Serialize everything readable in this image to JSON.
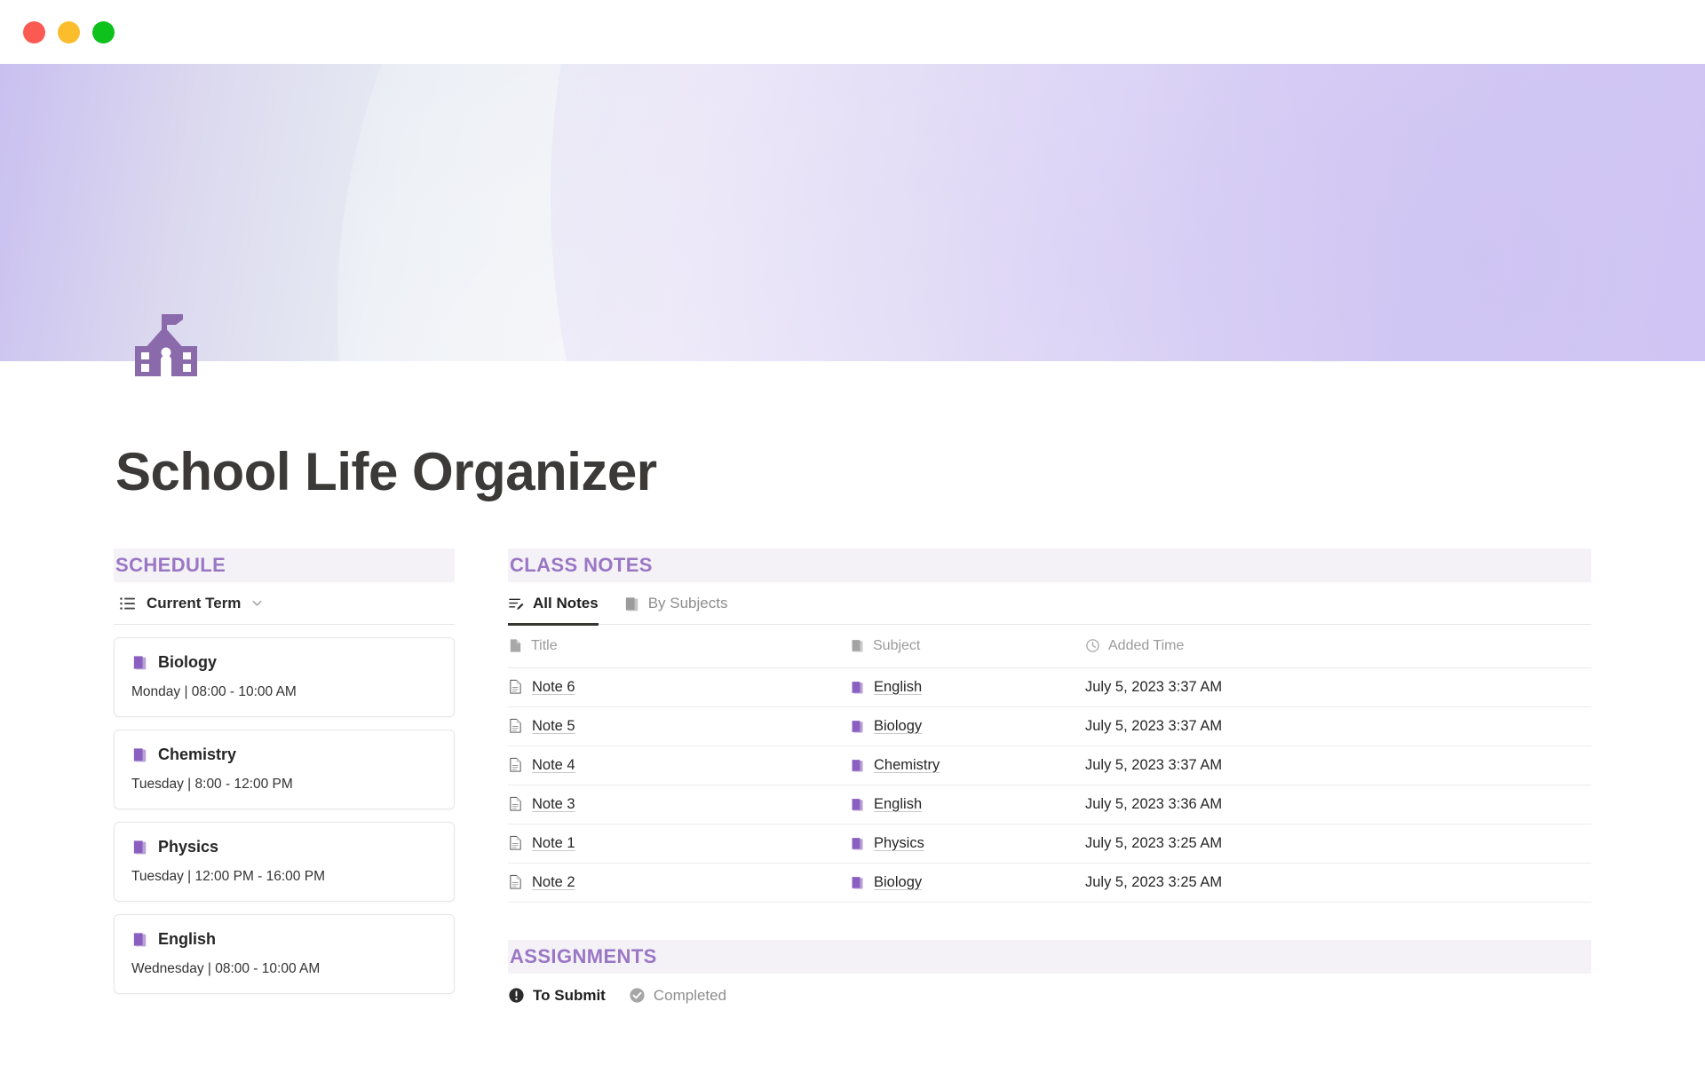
{
  "window": {
    "controls": [
      {
        "name": "close",
        "color": "#fb5a52"
      },
      {
        "name": "minimize",
        "color": "#fcbd2d"
      },
      {
        "name": "maximize",
        "color": "#0ec11d"
      }
    ]
  },
  "page": {
    "title": "School Life Organizer",
    "icon": "school-building-icon",
    "accent_color": "#9a77c4",
    "band_color": "#f4f2f7",
    "banner_gradient_from": "#c9c0f0",
    "banner_gradient_to": "#cfc3f3"
  },
  "schedule": {
    "heading": "SCHEDULE",
    "view": {
      "icon": "list-icon",
      "label": "Current Term",
      "chevron": "chevron-down-icon"
    },
    "cards": [
      {
        "icon": "book-icon",
        "subject": "Biology",
        "time": "Monday | 08:00 - 10:00 AM"
      },
      {
        "icon": "book-icon",
        "subject": "Chemistry",
        "time": "Tuesday | 8:00 - 12:00 PM"
      },
      {
        "icon": "book-icon",
        "subject": "Physics",
        "time": "Tuesday | 12:00 PM - 16:00 PM"
      },
      {
        "icon": "book-icon",
        "subject": "English",
        "time": "Wednesday | 08:00 - 10:00 AM"
      }
    ]
  },
  "class_notes": {
    "heading": "CLASS NOTES",
    "tabs": [
      {
        "label": "All Notes",
        "icon": "edit-list-icon",
        "active": true
      },
      {
        "label": "By Subjects",
        "icon": "book-icon",
        "active": false
      }
    ],
    "columns": [
      {
        "label": "Title",
        "icon": "page-icon"
      },
      {
        "label": "Subject",
        "icon": "book-icon"
      },
      {
        "label": "Added Time",
        "icon": "clock-icon"
      }
    ],
    "rows": [
      {
        "title": "Note 6",
        "subject": "English",
        "added_time": "July 5, 2023 3:37 AM"
      },
      {
        "title": "Note 5",
        "subject": "Biology",
        "added_time": "July 5, 2023 3:37 AM"
      },
      {
        "title": "Note 4",
        "subject": "Chemistry",
        "added_time": "July 5, 2023 3:37 AM"
      },
      {
        "title": "Note 3",
        "subject": "English",
        "added_time": "July 5, 2023 3:36 AM"
      },
      {
        "title": "Note 1",
        "subject": "Physics",
        "added_time": "July 5, 2023 3:25 AM"
      },
      {
        "title": "Note 2",
        "subject": "Biology",
        "added_time": "July 5, 2023 3:25 AM"
      }
    ]
  },
  "assignments": {
    "heading": "ASSIGNMENTS",
    "tabs": [
      {
        "label": "To Submit",
        "icon": "exclamation-circle-icon",
        "active": true
      },
      {
        "label": "Completed",
        "icon": "check-circle-icon",
        "active": false
      }
    ]
  }
}
